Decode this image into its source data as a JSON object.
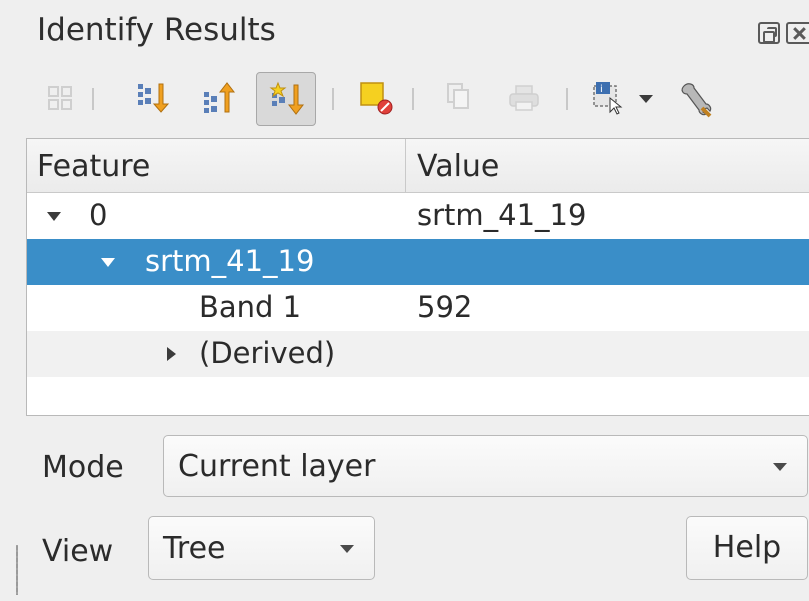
{
  "window": {
    "title": "Identify Results"
  },
  "toolbar": {
    "buttons": [
      {
        "icon": "expand-new-results-icon",
        "enabled": false
      },
      {
        "icon": "expand-all-icon",
        "enabled": true
      },
      {
        "icon": "collapse-all-icon",
        "enabled": true
      },
      {
        "icon": "expand-new-icon",
        "enabled": true,
        "active": true
      },
      {
        "icon": "clear-results-icon",
        "enabled": true
      },
      {
        "icon": "copy-icon",
        "enabled": false
      },
      {
        "icon": "print-icon",
        "enabled": false
      },
      {
        "icon": "identify-selection-icon",
        "enabled": true
      },
      {
        "icon": "dropdown-arrow-icon",
        "enabled": true
      },
      {
        "icon": "settings-wrench-icon",
        "enabled": true
      }
    ]
  },
  "tree": {
    "headers": {
      "feature": "Feature",
      "value": "Value"
    },
    "rows": [
      {
        "feature": "0",
        "value": "srtm_41_19",
        "expanded": true,
        "selected": false
      },
      {
        "feature": "srtm_41_19",
        "value": "",
        "expanded": true,
        "selected": true
      },
      {
        "feature": "Band 1",
        "value": "592",
        "selected": false
      },
      {
        "feature": "(Derived)",
        "value": "",
        "expanded": false,
        "selected": false
      }
    ]
  },
  "mode": {
    "label": "Mode",
    "selected": "Current layer"
  },
  "view": {
    "label": "View",
    "selected": "Tree"
  },
  "help_button": {
    "label": "Help"
  },
  "colors": {
    "selection": "#3a8ec8",
    "panel_bg": "#efefef",
    "tree_bg": "#ffffff"
  }
}
